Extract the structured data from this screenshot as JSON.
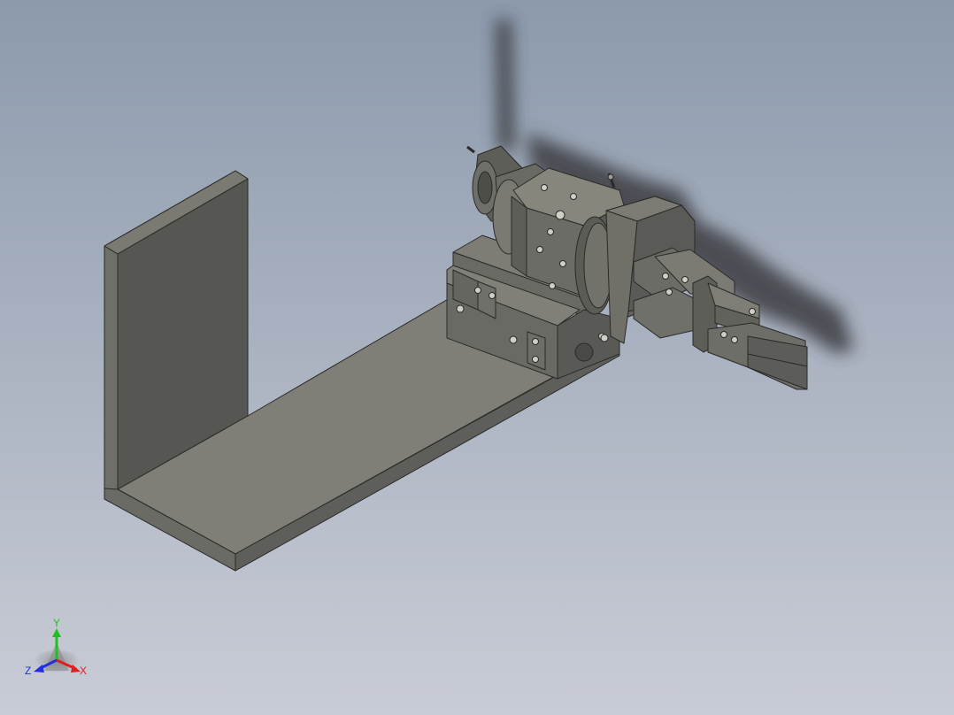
{
  "viewport": {
    "background_top": "#8C9AAC",
    "background_bottom": "#C9CCD6"
  },
  "model": {
    "base_colors": {
      "top": "#7F7F77",
      "side_dark": "#5B5B57",
      "side_mid": "#6E6E69",
      "edge": "#2A2A28"
    }
  },
  "triad": {
    "x_label": "X",
    "y_label": "Y",
    "z_label": "Z",
    "x_color": "#E02020",
    "y_color": "#20C020",
    "z_color": "#2030E0"
  }
}
